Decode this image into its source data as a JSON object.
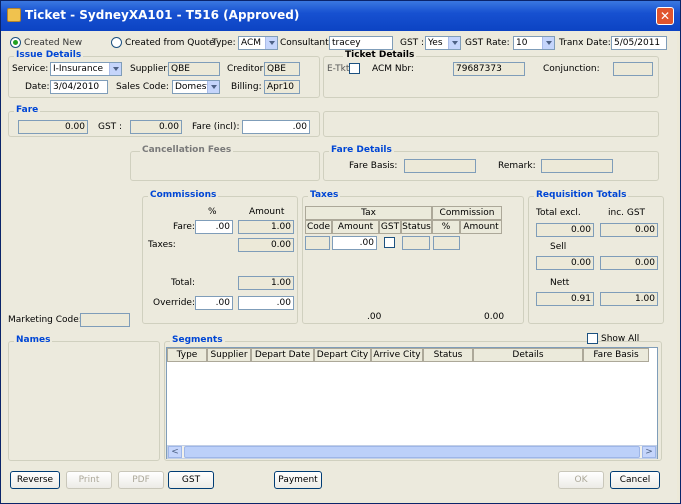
{
  "window": {
    "title": "Ticket - SydneyXA101 - T516 (Approved)"
  },
  "top": {
    "created_new": "Created New",
    "created_from_quote": "Created from Quote",
    "type_label": "Type:",
    "type_value": "ACM",
    "consultant_label": "Consultant:",
    "consultant_value": "tracey",
    "gst_label": "GST :",
    "gst_value": "Yes",
    "gst_rate_label": "GST Rate:",
    "gst_rate_value": "10",
    "tranx_date_label": "Tranx Date:",
    "tranx_date_value": "5/05/2011"
  },
  "issue": {
    "title": "Issue Details",
    "service_label": "Service:",
    "service_value": "I-Insurance",
    "supplier_label": "Supplier:",
    "supplier_value": "QBE",
    "creditor_label": "Creditor:",
    "creditor_value": "QBE",
    "date_label": "Date:",
    "date_value": "3/04/2010",
    "sales_code_label": "Sales Code:",
    "sales_code_value": "Domest",
    "billing_label": "Billing:",
    "billing_value": "Apr10"
  },
  "ticket": {
    "title": "Ticket Details",
    "etkt_label": "E-Tkt",
    "acm_label": "ACM Nbr:",
    "acm_value": "79687373",
    "conjunction_label": "Conjunction:",
    "conjunction_value": ""
  },
  "fare": {
    "title": "Fare",
    "fare_value": "0.00",
    "gst_label": "GST :",
    "gst_value": "0.00",
    "fare_incl_label": "Fare (incl):",
    "fare_incl_value": ".00"
  },
  "cancel": {
    "title": "Cancellation Fees"
  },
  "fare_details": {
    "title": "Fare Details",
    "fare_basis_label": "Fare Basis:",
    "fare_basis_value": "",
    "remark_label": "Remark:",
    "remark_value": ""
  },
  "commissions": {
    "title": "Commissions",
    "pct_header": "%",
    "amount_header": "Amount",
    "fare_label": "Fare:",
    "fare_pct": ".00",
    "fare_amount": "1.00",
    "taxes_label": "Taxes:",
    "taxes_amount": "0.00",
    "total_label": "Total:",
    "total_amount": "1.00",
    "override_label": "Override:",
    "override_pct": ".00",
    "override_amount": ".00"
  },
  "taxes": {
    "title": "Taxes",
    "group_tax": "Tax",
    "group_commission": "Commission",
    "columns": [
      "Code",
      "Amount",
      "GST",
      "Status",
      "%",
      "Amount"
    ],
    "row_amount": ".00",
    "total_tax": ".00",
    "total_commission": "0.00"
  },
  "requisition": {
    "title": "Requisition Totals",
    "total_excl_label": "Total excl.",
    "inc_gst_label": "inc. GST",
    "total_excl": "0.00",
    "total_inc": "0.00",
    "sell_label": "Sell",
    "sell_excl": "0.00",
    "sell_inc": "0.00",
    "nett_label": "Nett",
    "nett_excl": "0.91",
    "nett_inc": "1.00"
  },
  "marketing": {
    "label": "Marketing Code:",
    "value": ""
  },
  "names": {
    "title": "Names"
  },
  "segments": {
    "title": "Segments",
    "show_all_label": "Show All",
    "columns": [
      "Type",
      "Supplier",
      "Depart Date",
      "Depart City",
      "Arrive City",
      "Status",
      "Details",
      "Fare Basis"
    ]
  },
  "buttons": {
    "reverse": "Reverse",
    "print": "Print",
    "pdf": "PDF",
    "gst": "GST",
    "payment": "Payment",
    "ok": "OK",
    "cancel": "Cancel"
  }
}
